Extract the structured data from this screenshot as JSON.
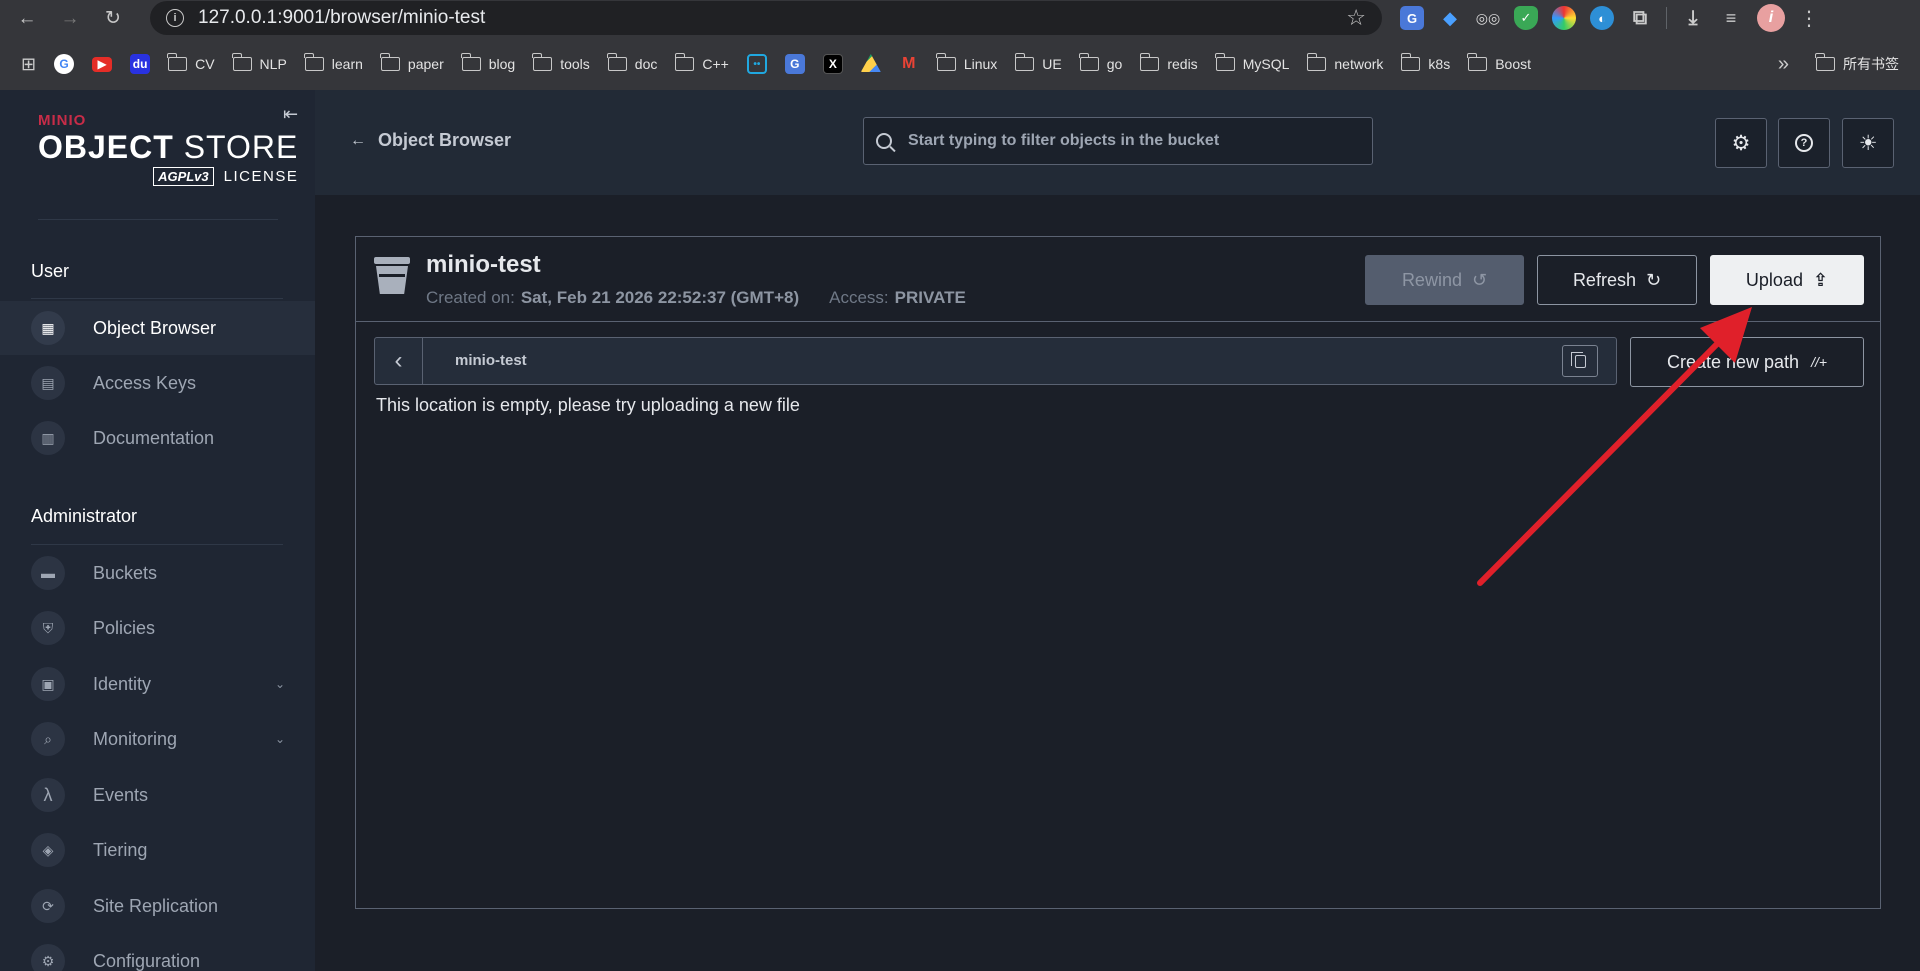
{
  "browser": {
    "url": "127.0.0.1:9001/browser/minio-test",
    "bookmarks": [
      "CV",
      "NLP",
      "learn",
      "paper",
      "blog",
      "tools",
      "doc",
      "C++",
      "Linux",
      "UE",
      "go",
      "redis",
      "MySQL",
      "network",
      "k8s",
      "Boost"
    ],
    "all_bookmarks_label": "所有书签",
    "more_glyph": "»"
  },
  "sidebar": {
    "logo": {
      "brand": "MINIO",
      "title_bold": "OBJECT",
      "title_rest": " STORE",
      "badge": "AGPLv3",
      "license": "LICENSE"
    },
    "user_section": "User",
    "user_items": [
      {
        "label": "Object Browser",
        "icon": "object-browser-icon",
        "active": true
      },
      {
        "label": "Access Keys",
        "icon": "access-keys-icon"
      },
      {
        "label": "Documentation",
        "icon": "documentation-icon"
      }
    ],
    "admin_section": "Administrator",
    "admin_items": [
      {
        "label": "Buckets",
        "icon": "bucket-icon"
      },
      {
        "label": "Policies",
        "icon": "policy-icon"
      },
      {
        "label": "Identity",
        "icon": "identity-icon",
        "expandable": true
      },
      {
        "label": "Monitoring",
        "icon": "monitoring-icon",
        "expandable": true
      },
      {
        "label": "Events",
        "icon": "lambda-icon"
      },
      {
        "label": "Tiering",
        "icon": "tiering-icon"
      },
      {
        "label": "Site Replication",
        "icon": "replication-icon"
      },
      {
        "label": "Configuration",
        "icon": "gear-icon"
      }
    ]
  },
  "header": {
    "back_label": "Object Browser",
    "search_placeholder": "Start typing to filter objects in the bucket"
  },
  "bucket": {
    "name": "minio-test",
    "created_label": "Created on:",
    "created_value": "Sat, Feb 21 2026 22:52:37 (GMT+8)",
    "access_label": "Access:",
    "access_value": "PRIVATE",
    "rewind_label": "Rewind",
    "refresh_label": "Refresh",
    "upload_label": "Upload",
    "path": "minio-test",
    "new_path_label": "Create new path",
    "empty_message": "This location is empty, please try uploading a new file"
  },
  "colors": {
    "accent_red": "#e0202a",
    "brand": "#c72c48",
    "sidebar_bg": "#1f2633",
    "main_bg": "#1b1f28"
  }
}
